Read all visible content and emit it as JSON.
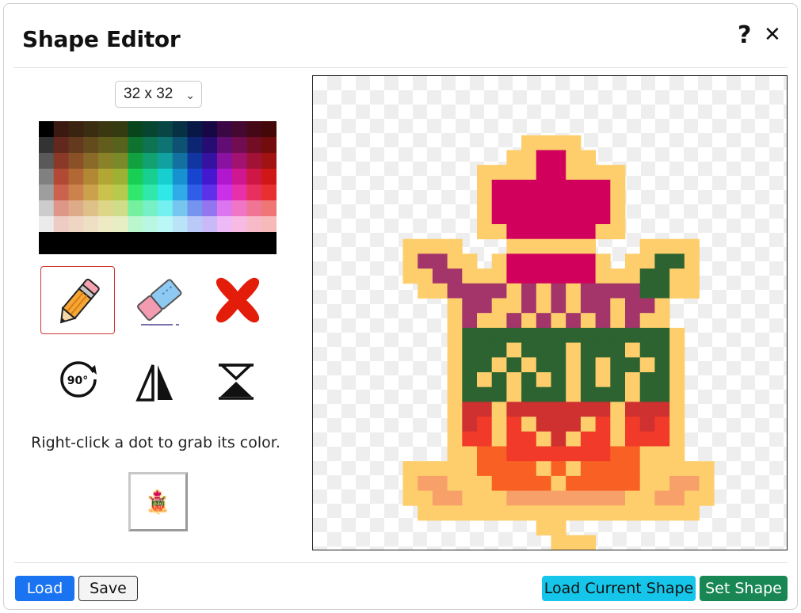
{
  "dialog": {
    "title": "Shape Editor",
    "help_icon": "question-mark-icon",
    "close_icon": "close-icon"
  },
  "size_select": {
    "value": "32 x 32"
  },
  "tools": [
    {
      "name": "pencil",
      "icon": "pencil-icon",
      "selected": true
    },
    {
      "name": "eraser",
      "icon": "eraser-icon",
      "selected": false
    },
    {
      "name": "clear",
      "icon": "clear-x-icon",
      "selected": false
    },
    {
      "name": "rotate",
      "icon": "rotate-90-icon",
      "label": "90°",
      "selected": false
    },
    {
      "name": "flip-horizontal",
      "icon": "flip-horizontal-icon",
      "selected": false
    },
    {
      "name": "flip-vertical",
      "icon": "flip-vertical-icon",
      "selected": false
    }
  ],
  "hint": "Right-click a dot to grab its color.",
  "buttons": {
    "load": "Load",
    "save": "Save",
    "load_current": "Load Current Shape",
    "set_shape": "Set Shape"
  },
  "colors": {
    "load_button": "#1a73f0",
    "load_current_button": "#16c6ea",
    "set_shape_button": "#198754",
    "selected_tool_border": "#d43434"
  },
  "palette": {
    "legend": {
      "Y": "#fdce6b",
      "M": "#d1005c",
      "P": "#a3356a",
      "G": "#2c6330",
      "R": "#cf3030",
      "r": "#f23a2a",
      "o": "#f96124",
      "S": "#f8a06a"
    },
    "rows": [
      "000000000000000000000000000000",
      "000000000000000000000000000000",
      "000000000000000000000000000000",
      "000000000000000000000000000000",
      "0000000000000YYYY0000000000000",
      "000000000000YYMMYY000000000000",
      "0000000000YYYYMMYYYY0000000000",
      "0000000000YMMMMMMMMY0000000000",
      "0000000000YMMMMMMMMY0000000000",
      "0000000000YMMMMMMMMY0000000000",
      "0000000000YYMMMMMMYY0000000000",
      "00000YYYY000YYYYYY000YYYY00000",
      "00000YPPYY0YMMMMMMY0YYGGY00000",
      "00000YYPPYYYMMMMMMYYYGGYY00000",
      "000000YYPPPPYPYPYPPPPGGYY00000",
      "00000000YPPYYPYPYPPYPPY0000000",
      "00000000YPYYPYPYPYPYPYY0000000",
      "00000000YGGGGGGGGGGGGGGY000000",
      "00000000YGGGYGGGYGGGYGGY000000",
      "00000000YGGYGYGGYGYGGYGY000000",
      "00000000YGYGYGYGYGYGYGGY000000",
      "00000000YGGGYGGGYGGGYGGY000000",
      "00000000YRRYRRRRRRRYRRRY000000",
      "00000000YRrYrYRRRYrYrRrY000000",
      "00000000YrrYrrYRYrrYrrrY000000",
      "00000000YYoorrrrrrrooYYY000000",
      "00000YYYYYooooYoYooooYYYYY00000",
      "00000YSSYYYooooYoooooYYSSY00000",
      "00000YYSSYYYSSSSSSSSYYSSYY00000",
      "000000YYYYYYYYYYYYYYYYYYY000000",
      "00000000000000YY00000000000000",
      "000000000000000YYY000000000000"
    ]
  }
}
